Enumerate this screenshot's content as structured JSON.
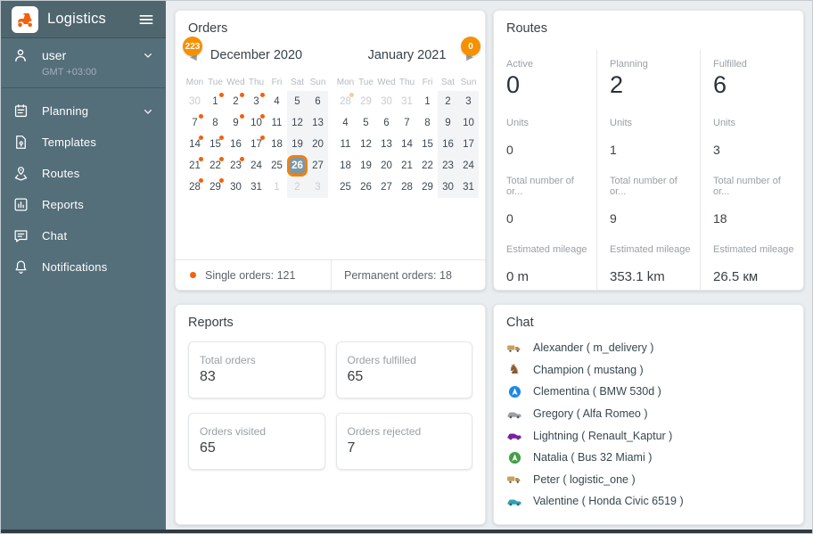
{
  "colors": {
    "accent_orange": "#f59100",
    "dot_orange": "#f4600c",
    "sidebar_bg": "#546e7a",
    "selected_day_fill": "#7e98a3",
    "selected_day_border": "#f57f0d"
  },
  "sidebar": {
    "app_title": "Logistics",
    "user": {
      "name": "user",
      "timezone": "GMT +03:00"
    },
    "items": [
      {
        "id": "planning",
        "label": "Planning",
        "icon": "calendar-icon",
        "expandable": true
      },
      {
        "id": "templates",
        "label": "Templates",
        "icon": "template-icon",
        "expandable": false
      },
      {
        "id": "routes",
        "label": "Routes",
        "icon": "route-pin-icon",
        "expandable": false
      },
      {
        "id": "reports",
        "label": "Reports",
        "icon": "bar-chart-icon",
        "expandable": false
      },
      {
        "id": "chat",
        "label": "Chat",
        "icon": "chat-icon",
        "expandable": false
      },
      {
        "id": "notifications",
        "label": "Notifications",
        "icon": "bell-icon",
        "expandable": false
      }
    ]
  },
  "orders": {
    "title": "Orders",
    "weekdays": [
      "Mon",
      "Tue",
      "Wed",
      "Thu",
      "Fri",
      "Sat",
      "Sun"
    ],
    "months": [
      {
        "label": "December 2020",
        "badge": "223",
        "nav": "prev",
        "weeks": [
          [
            {
              "d": "30",
              "out": true
            },
            {
              "d": "1",
              "dot": true
            },
            {
              "d": "2",
              "dot": true
            },
            {
              "d": "3",
              "dot": true
            },
            {
              "d": "4"
            },
            {
              "d": "5"
            },
            {
              "d": "6"
            }
          ],
          [
            {
              "d": "7",
              "dot": true
            },
            {
              "d": "8"
            },
            {
              "d": "9",
              "dot": true
            },
            {
              "d": "10",
              "dot": true
            },
            {
              "d": "11"
            },
            {
              "d": "12"
            },
            {
              "d": "13"
            }
          ],
          [
            {
              "d": "14",
              "dot": true
            },
            {
              "d": "15",
              "dot": true
            },
            {
              "d": "16"
            },
            {
              "d": "17",
              "dot": true
            },
            {
              "d": "18"
            },
            {
              "d": "19"
            },
            {
              "d": "20"
            }
          ],
          [
            {
              "d": "21",
              "dot": true
            },
            {
              "d": "22",
              "dot": true
            },
            {
              "d": "23",
              "dot": true
            },
            {
              "d": "24"
            },
            {
              "d": "25"
            },
            {
              "d": "26",
              "selected": true
            },
            {
              "d": "27"
            }
          ],
          [
            {
              "d": "28",
              "dot": true
            },
            {
              "d": "29",
              "dot": true
            },
            {
              "d": "30"
            },
            {
              "d": "31"
            },
            {
              "d": "1",
              "out": true
            },
            {
              "d": "2",
              "out": true
            },
            {
              "d": "3",
              "out": true
            }
          ]
        ]
      },
      {
        "label": "January 2021",
        "badge": "0",
        "nav": "next",
        "weeks": [
          [
            {
              "d": "28",
              "out": true,
              "faded": true
            },
            {
              "d": "29",
              "out": true
            },
            {
              "d": "30",
              "out": true
            },
            {
              "d": "31",
              "out": true
            },
            {
              "d": "1"
            },
            {
              "d": "2"
            },
            {
              "d": "3"
            }
          ],
          [
            {
              "d": "4"
            },
            {
              "d": "5"
            },
            {
              "d": "6"
            },
            {
              "d": "7"
            },
            {
              "d": "8"
            },
            {
              "d": "9"
            },
            {
              "d": "10"
            }
          ],
          [
            {
              "d": "11"
            },
            {
              "d": "12"
            },
            {
              "d": "13"
            },
            {
              "d": "14"
            },
            {
              "d": "15"
            },
            {
              "d": "16"
            },
            {
              "d": "17"
            }
          ],
          [
            {
              "d": "18"
            },
            {
              "d": "19"
            },
            {
              "d": "20"
            },
            {
              "d": "21"
            },
            {
              "d": "22"
            },
            {
              "d": "23"
            },
            {
              "d": "24"
            }
          ],
          [
            {
              "d": "25"
            },
            {
              "d": "26"
            },
            {
              "d": "27"
            },
            {
              "d": "28"
            },
            {
              "d": "29"
            },
            {
              "d": "30"
            },
            {
              "d": "31"
            }
          ]
        ]
      }
    ],
    "footer": {
      "single": "Single orders: 121",
      "permanent": "Permanent orders: 18"
    }
  },
  "routes": {
    "title": "Routes",
    "units_label": "Units",
    "orders_label": "Total number of or...",
    "mileage_label": "Estimated mileage",
    "columns": [
      {
        "status": "Active",
        "count": "0",
        "units": "0",
        "orders": "0",
        "mileage": "0 m"
      },
      {
        "status": "Planning",
        "count": "2",
        "units": "1",
        "orders": "9",
        "mileage": "353.1 km"
      },
      {
        "status": "Fulfilled",
        "count": "6",
        "units": "3",
        "orders": "18",
        "mileage": "26.5 км"
      }
    ]
  },
  "reports": {
    "title": "Reports",
    "cards": [
      {
        "label": "Total orders",
        "value": "83"
      },
      {
        "label": "Orders fulfilled",
        "value": "65"
      },
      {
        "label": "Orders visited",
        "value": "65"
      },
      {
        "label": "Orders rejected",
        "value": "7"
      }
    ]
  },
  "chat": {
    "title": "Chat",
    "items": [
      {
        "icon": "truck-icon",
        "name": "Alexander ( m_delivery )"
      },
      {
        "icon": "horse-icon",
        "name": "Champion ( mustang )"
      },
      {
        "icon": "nav-arrow-blue-icon",
        "name": "Clementina ( BMW 530d )"
      },
      {
        "icon": "car-gray-icon",
        "name": "Gregory ( Alfa Romeo )"
      },
      {
        "icon": "car-purple-icon",
        "name": "Lightning ( Renault_Kaptur )"
      },
      {
        "icon": "nav-arrow-green-icon",
        "name": "Natalia ( Bus 32 Miami )"
      },
      {
        "icon": "truck-icon",
        "name": "Peter ( logistic_one )"
      },
      {
        "icon": "car-teal-icon",
        "name": "Valentine ( Honda Civic 6519 )"
      }
    ]
  }
}
